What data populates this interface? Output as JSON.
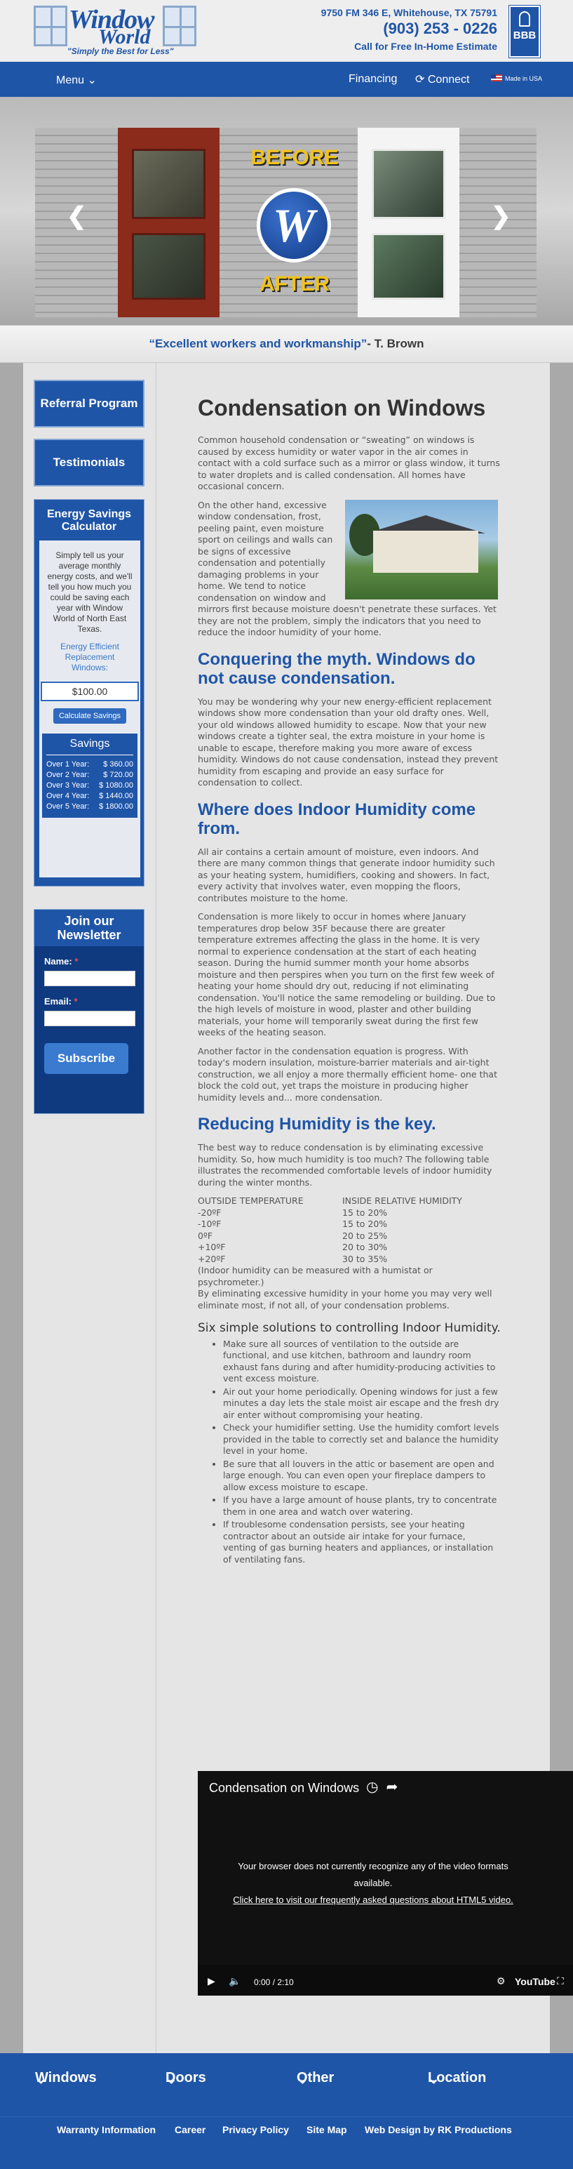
{
  "header": {
    "logo_word1": "Window",
    "logo_word2": "World",
    "tagline": "\"Simply the Best for Less\"",
    "address": "9750 FM 346 E, Whitehouse, TX 75791",
    "phone": "(903) 253 - 0226",
    "call_to_action": "Call for Free In-Home Estimate",
    "bbb_label": "BBB"
  },
  "nav": {
    "menu": "Menu",
    "financing": "Financing",
    "connect": "Connect",
    "made_in_usa": "Made in USA"
  },
  "slider": {
    "before_label": "BEFORE",
    "after_label": "AFTER",
    "badge_letter": "W"
  },
  "testimonial": {
    "quote": "“Excellent workers and workmanship”",
    "author": "- T. Brown"
  },
  "sidebar": {
    "referral": "Referral Program",
    "testimonials": "Testimonials",
    "calculator": {
      "title": "Energy Savings Calculator",
      "description": "Simply tell us your average monthly energy costs, and we'll tell you how much you could be saving each year with Window World of North East Texas.",
      "link": "Energy Efficient Replacement Windows:",
      "input_value": "$100.00",
      "button": "Calculate Savings",
      "savings_title": "Savings",
      "savings": [
        {
          "label": "Over 1 Year:",
          "value": "$ 360.00"
        },
        {
          "label": "Over 2 Year:",
          "value": "$ 720.00"
        },
        {
          "label": "Over 3 Year:",
          "value": "$ 1080.00"
        },
        {
          "label": "Over 4 Year:",
          "value": "$ 1440.00"
        },
        {
          "label": "Over 5 Year:",
          "value": "$ 1800.00"
        }
      ]
    },
    "newsletter": {
      "title": "Join our Newsletter",
      "name_label": "Name:",
      "email_label": "Email:",
      "required_mark": "*",
      "subscribe": "Subscribe"
    }
  },
  "article": {
    "title": "Condensation on Windows",
    "p1": "Common household condensation or “sweating” on windows is caused by excess humidity or water vapor in the air comes in contact with a cold surface such as a mirror or glass window, it turns to water droplets and is called condensation. All homes have occasional concern.",
    "p2": "On the other hand, excessive window condensation, frost, peeling paint, even moisture sport on ceilings and walls can be signs of excessive condensation and potentially damaging problems in your home. We tend to notice condensation on window and mirrors first because moisture doesn't penetrate these surfaces. Yet they are not the problem, simply the indicators that you need to reduce the indoor humidity of your home.",
    "h2a": "Conquering the myth. Windows do not cause condensation.",
    "p3": "You may be wondering why your new energy-efficient replacement windows show more condensation than your old drafty ones. Well, your old windows allowed humidity to escape. Now that your new windows create a tighter seal, the extra moisture in your home is unable to escape, therefore making you more aware of excess humidity. Windows do not cause condensation, instead they prevent humidity from escaping and provide an easy surface for condensation to collect.",
    "h2b": "Where does Indoor Humidity come from.",
    "p4": "All air contains a certain amount of moisture, even indoors. And there are many common things that generate indoor humidity such as your heating system, humidifiers, cooking and showers. In fact, every activity that involves water, even mopping the floors, contributes moisture to the home.",
    "p5": "Condensation is more likely to occur in homes where January temperatures drop below 35F because there are greater temperature extremes affecting the glass in the home. It is very normal to experience condensation at the start of each heating season. During the humid summer month your home absorbs moisture and then perspires when you turn on the first few week of heating your home should dry out, reducing if not eliminating condensation. You'll notice the same remodeling or building. Due to the high levels of moisture in wood, plaster and other building materials, your home will temporarily sweat during the first few weeks of the heating season.",
    "p6": "Another factor in the condensation equation is progress. With today's modern insulation, moisture-barrier materials and air-tight construction, we all enjoy a more thermally efficient home- one that block the cold out, yet traps the moisture in producing higher humidity levels and... more condensation.",
    "h2c": "Reducing Humidity is the key.",
    "p7": "The best way to reduce condensation is by eliminating excessive humidity. So, how much humidity is too much? The following table illustrates the recommended comfortable levels of indoor humidity during the winter months.",
    "table_headers": [
      "OUTSIDE TEMPERATURE",
      "INSIDE RELATIVE HUMIDITY"
    ],
    "table_rows": [
      [
        "-20ºF",
        "15 to 20%"
      ],
      [
        "-10ºF",
        "15 to 20%"
      ],
      [
        "0ºF",
        "20 to 25%"
      ],
      [
        "+10ºF",
        "20 to 30%"
      ],
      [
        "+20ºF",
        "30 to 35%"
      ]
    ],
    "p8": "(Indoor humidity can be measured with a humistat or psychrometer.)",
    "p9": "By eliminating excessive humidity in your home you may very well eliminate most, if not all, of your condensation problems.",
    "h3": "Six simple solutions to controlling Indoor Humidity.",
    "solutions": [
      "Make sure all sources of ventilation to the outside are functional, and use kitchen, bathroom and laundry room exhaust fans during and after humidity-producing activities to vent excess moisture.",
      "Air out your home periodically. Opening windows for just a few minutes a day lets the stale moist air escape and the fresh dry air enter without compromising your heating.",
      "Check your humidifier setting. Use the humidity comfort levels provided in the table to correctly set and balance the humidity level in your home.",
      "Be sure that all louvers in the attic or basement are open and large enough. You can even open your fireplace dampers to allow excess moisture to escape.",
      "If you have a large amount of house plants, try to concentrate them in one area and watch over watering.",
      "If troublesome condensation persists, see your heating contractor about an outside air intake for your furnace, venting of gas burning heaters and appliances, or installation of ventilating fans."
    ]
  },
  "video": {
    "title": "Condensation on Windows",
    "message": "Your browser does not currently recognize any of the video formats available.",
    "link": "Click here to visit our frequently asked questions about HTML5 video.",
    "time": "0:00 / 2:10",
    "brand": "YouTube"
  },
  "footer_nav": [
    "Windows",
    "Doors",
    "Other",
    "Location"
  ],
  "footer_links": [
    "Warranty Information",
    "Career",
    "Privacy Policy",
    "Site Map",
    "Web Design by RK Productions"
  ],
  "colors": {
    "brand_blue": "#1f55a7",
    "accent_gold": "#f0c21c",
    "window_red": "#8b2b1c"
  }
}
